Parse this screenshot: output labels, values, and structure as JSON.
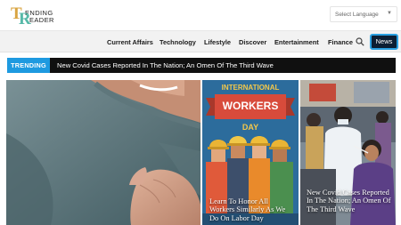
{
  "brand": {
    "letter_t": "T",
    "letter_r": "R",
    "word_1": "ENDING",
    "word_2": "EADER"
  },
  "language_select": {
    "selected": "Select Language"
  },
  "nav": {
    "items": [
      {
        "label": "Current Affairs"
      },
      {
        "label": "Technology"
      },
      {
        "label": "Lifestyle"
      },
      {
        "label": "Discover"
      },
      {
        "label": "Entertainment"
      },
      {
        "label": "Finance"
      }
    ],
    "news_button": "News"
  },
  "trending": {
    "label": "TRENDING",
    "headline": "New Covid Cases Reported In The Nation; An Omen Of The Third Wave"
  },
  "featured": [
    {
      "caption": ""
    },
    {
      "poster_title_1": "INTERNATIONAL",
      "poster_title_2": "WORKERS",
      "poster_title_3": "DAY",
      "caption": "Learn To Honor All Workers Similarly As We Do On Labor Day"
    },
    {
      "caption": "New Covid Cases Reported In The Nation; An Omen Of The Third Wave"
    }
  ],
  "colors": {
    "accent_blue": "#1e9ae0",
    "news_button_bg": "#0c1e33",
    "logo_gold": "#d9a441",
    "logo_teal": "#57b9a8"
  },
  "icons": {
    "search": "search-icon",
    "dropdown": "chevron-down-icon"
  }
}
